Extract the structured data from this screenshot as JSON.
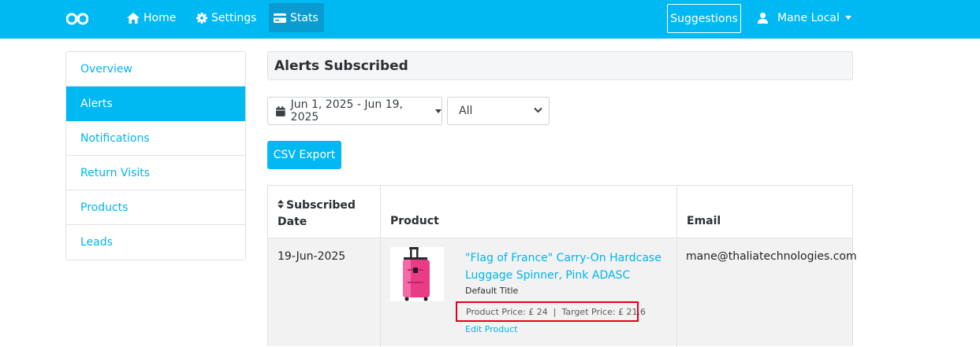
{
  "nav": {
    "logo_icon": "binoculars-icon",
    "home": "Home",
    "settings": "Settings",
    "stats": "Stats",
    "suggestions": "Suggestions",
    "user": "Mane Local"
  },
  "sidebar": {
    "items": [
      {
        "label": "Overview"
      },
      {
        "label": "Alerts",
        "active": true
      },
      {
        "label": "Notifications"
      },
      {
        "label": "Return Visits"
      },
      {
        "label": "Products"
      },
      {
        "label": "Leads"
      }
    ]
  },
  "main": {
    "title": "Alerts Subscribed",
    "date_range": "Jun 1, 2025 - Jun 19, 2025",
    "filter_selected": "All",
    "csv_export": "CSV Export"
  },
  "table": {
    "headers": {
      "date_line1": "Subscribed",
      "date_line2": "Date",
      "product": "Product",
      "email": "Email"
    },
    "rows": [
      {
        "date": "19-Jun-2025",
        "product_title": "\"Flag of France\" Carry-On Hardcase Luggage Spinner, Pink ADASC",
        "variant": "Default Title",
        "prices": "Product Price: £ 24  |  Target Price: £ 21.6",
        "edit": "Edit Product",
        "email": "mane@thaliatechnologies.com"
      }
    ]
  },
  "colors": {
    "accent": "#00b9f2",
    "link": "#00b4ee",
    "highlight_border": "#e3001b"
  }
}
